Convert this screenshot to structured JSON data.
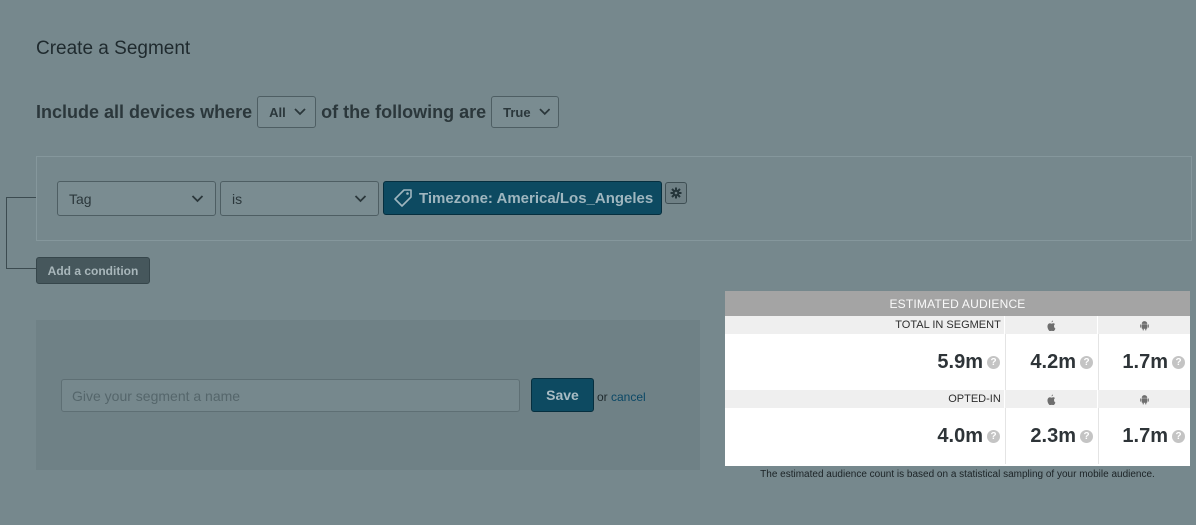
{
  "page": {
    "title": "Create a Segment"
  },
  "include": {
    "prefix": "Include all devices where",
    "match_value": "All",
    "middle": "of the following are",
    "truth_value": "True"
  },
  "condition": {
    "field": "Tag",
    "operator": "is",
    "tag_value": "Timezone: America/Los_Angeles",
    "add_label": "Add a condition"
  },
  "name_form": {
    "placeholder": "Give your segment a name",
    "save_label": "Save",
    "or_text": "or",
    "cancel_label": "cancel"
  },
  "audience": {
    "header": "ESTIMATED AUDIENCE",
    "rows": [
      {
        "label": "TOTAL IN SEGMENT",
        "total": "5.9m",
        "ios": "4.2m",
        "android": "1.7m"
      },
      {
        "label": "OPTED-IN",
        "total": "4.0m",
        "ios": "2.3m",
        "android": "1.7m"
      }
    ],
    "note": "The estimated audience count is based on a statistical sampling of your mobile audience.",
    "help_glyph": "?"
  },
  "colors": {
    "overlay": "#76888d",
    "primary": "#0d4a61"
  }
}
